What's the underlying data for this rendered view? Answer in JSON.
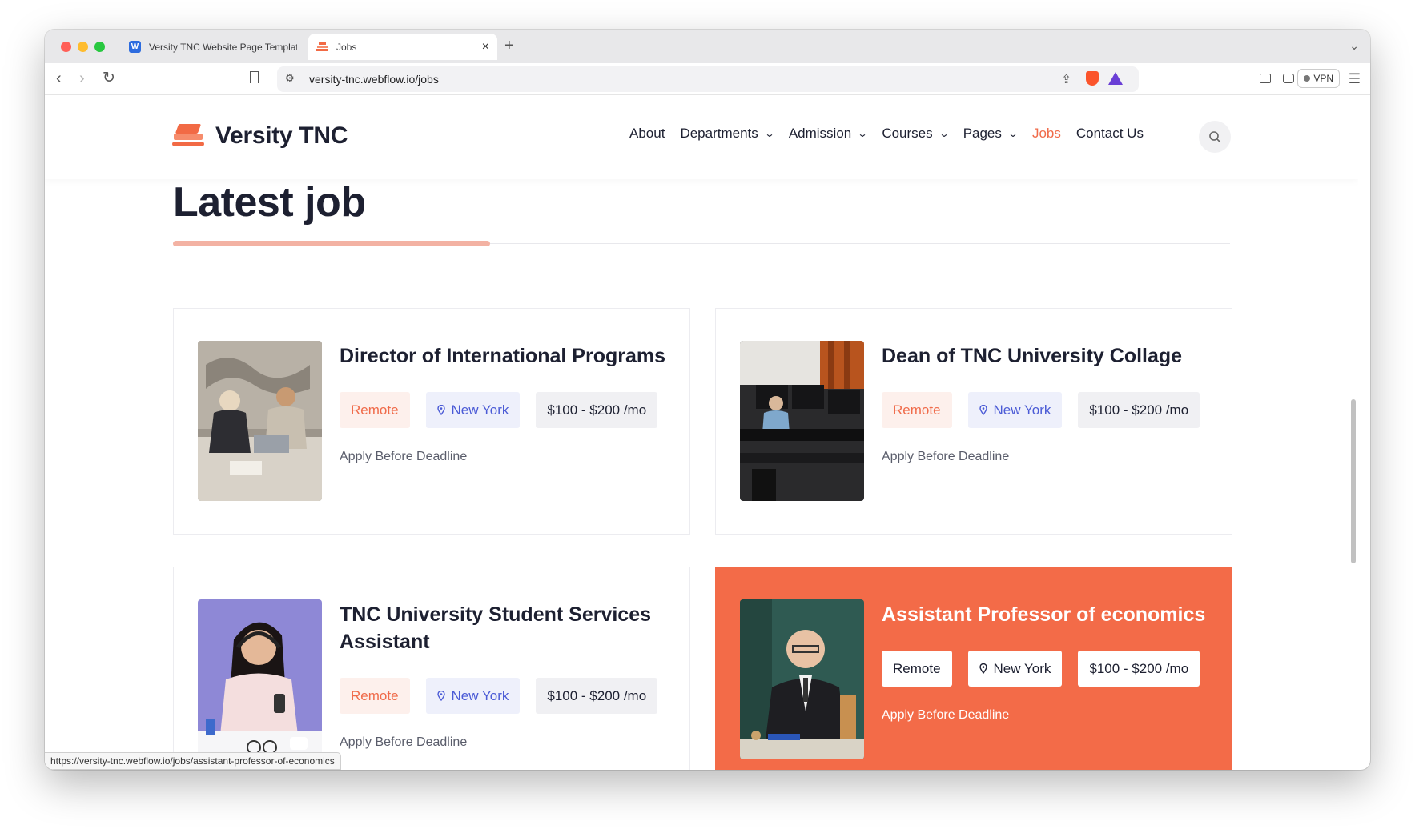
{
  "browser": {
    "tabs": [
      {
        "title": "Versity TNC Website Page Template",
        "favicon": "webflow-icon",
        "active": false
      },
      {
        "title": "Jobs",
        "favicon": "versity-logo-icon",
        "active": true
      }
    ],
    "new_tab_glyph": "+",
    "tab_close_glyph": "×",
    "url": "versity-tnc.webflow.io/jobs",
    "vpn_label": "VPN",
    "status_url": "https://versity-tnc.webflow.io/jobs/assistant-professor-of-economics"
  },
  "site": {
    "brand": "Versity TNC",
    "accent_color": "#f36b48",
    "nav": [
      {
        "label": "About",
        "dropdown": false,
        "active": false
      },
      {
        "label": "Departments",
        "dropdown": true,
        "active": false
      },
      {
        "label": "Admission",
        "dropdown": true,
        "active": false
      },
      {
        "label": "Courses",
        "dropdown": true,
        "active": false
      },
      {
        "label": "Pages",
        "dropdown": true,
        "active": false
      },
      {
        "label": "Jobs",
        "dropdown": false,
        "active": true
      },
      {
        "label": "Contact Us",
        "dropdown": false,
        "active": false
      }
    ]
  },
  "main": {
    "heading": "Latest job",
    "jobs": [
      {
        "title": "Director of International Programs",
        "type": "Remote",
        "location": "New York",
        "salary": "$100 - $200 /mo",
        "deadline": "Apply Before Deadline",
        "featured": false,
        "image": "office-meeting-photo"
      },
      {
        "title": "Dean of TNC University Collage",
        "type": "Remote",
        "location": "New York",
        "salary": "$100 - $200 /mo",
        "deadline": "Apply Before Deadline",
        "featured": false,
        "image": "computer-lab-photo"
      },
      {
        "title": "TNC University Student Services Assistant",
        "type": "Remote",
        "location": "New York",
        "salary": "$100 - $200 /mo",
        "deadline": "Apply Before Deadline",
        "featured": false,
        "image": "support-agent-photo"
      },
      {
        "title": "Assistant Professor of economics",
        "type": "Remote",
        "location": "New York",
        "salary": "$100 - $200 /mo",
        "deadline": "Apply Before Deadline",
        "featured": true,
        "image": "professor-photo"
      }
    ]
  }
}
